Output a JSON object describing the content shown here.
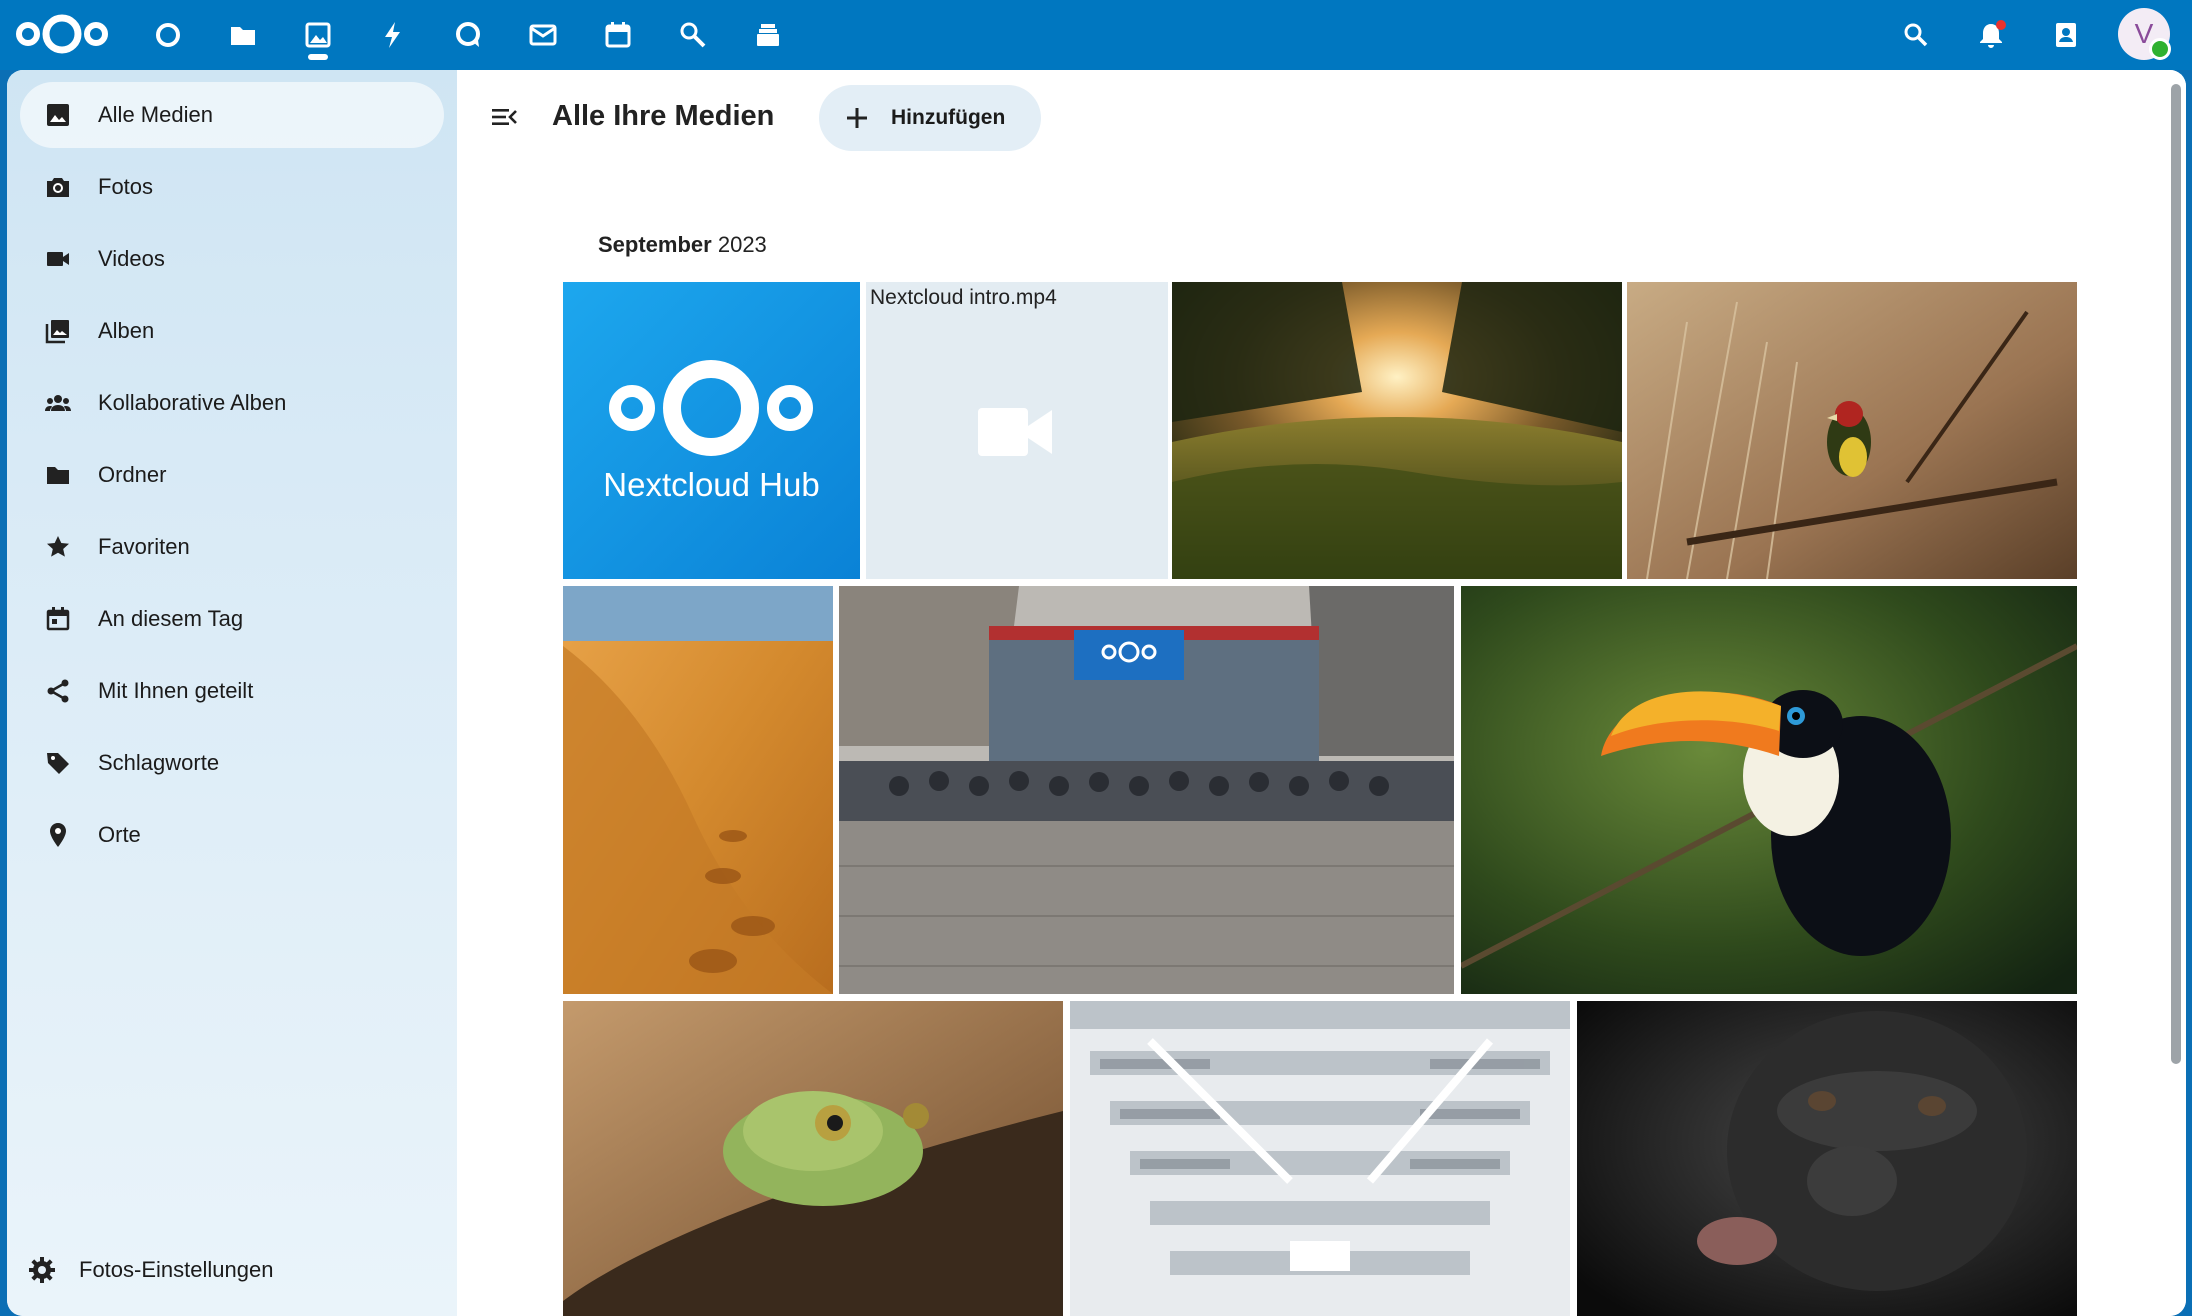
{
  "header": {
    "apps": [
      "dashboard",
      "files",
      "photos",
      "activity",
      "talk",
      "mail",
      "calendar",
      "search-app",
      "deck"
    ],
    "active_app": "photos",
    "avatar_initial": "V",
    "accent": "#0077c0"
  },
  "sidebar": {
    "items": [
      {
        "label": "Alle Medien",
        "icon": "image-icon"
      },
      {
        "label": "Fotos",
        "icon": "camera-icon"
      },
      {
        "label": "Videos",
        "icon": "video-icon"
      },
      {
        "label": "Alben",
        "icon": "albums-icon"
      },
      {
        "label": "Kollaborative Alben",
        "icon": "people-icon"
      },
      {
        "label": "Ordner",
        "icon": "folder-icon"
      },
      {
        "label": "Favoriten",
        "icon": "star-icon"
      },
      {
        "label": "An diesem Tag",
        "icon": "calendar-icon"
      },
      {
        "label": "Mit Ihnen geteilt",
        "icon": "share-icon"
      },
      {
        "label": "Schlagworte",
        "icon": "tag-icon"
      },
      {
        "label": "Orte",
        "icon": "map-marker-icon"
      }
    ],
    "settings_label": "Fotos-Einstellungen"
  },
  "main": {
    "title": "Alle Ihre Medien",
    "add_button": "Hinzufügen",
    "month_bold": "September",
    "month_year": "2023",
    "logo_tile_text": "Nextcloud Hub",
    "video_name": "Nextcloud intro.mp4",
    "media": [
      "Nextcloud Hub logo",
      "Nextcloud intro.mp4",
      "vineyard sunset",
      "finch on branch",
      "desert dunes",
      "group photo",
      "toucan",
      "frog",
      "library",
      "gorilla"
    ]
  }
}
